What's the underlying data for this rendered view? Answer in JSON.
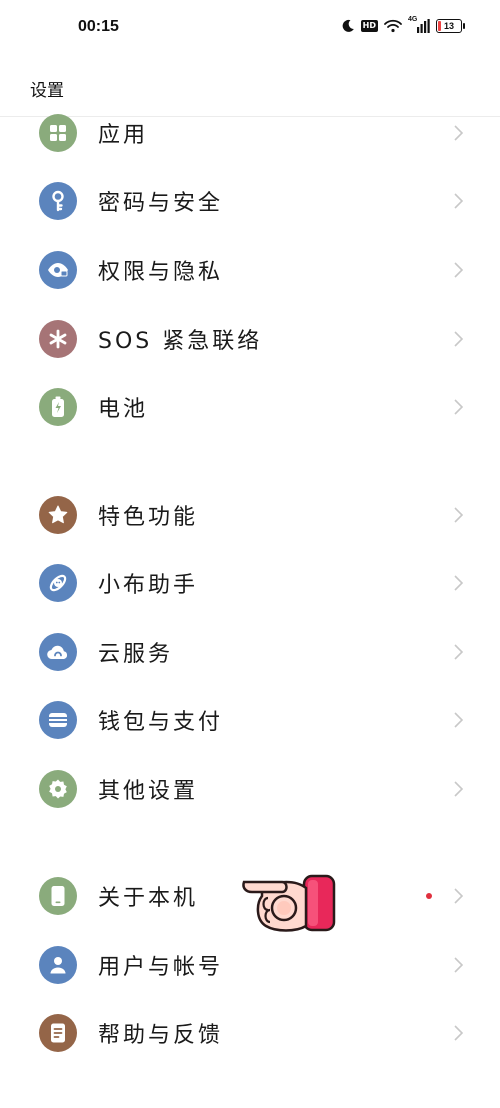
{
  "status_bar": {
    "time": "00:15",
    "icons": [
      "moon-icon",
      "hd-icon",
      "wifi-icon",
      "4g-signal-icon",
      "battery-icon"
    ],
    "hd_label": "HD",
    "network_label": "4G",
    "battery_level": "13"
  },
  "header": {
    "title": "设置"
  },
  "colors": {
    "green": "#8aab7c",
    "blue": "#5b84bd",
    "mauve": "#a67476",
    "brown": "#946548",
    "notification_dot": "#e0303e"
  },
  "groups": [
    {
      "items": [
        {
          "label": "应用",
          "icon": "apps-grid-icon"
        },
        {
          "label": "密码与安全",
          "icon": "key-icon"
        },
        {
          "label": "权限与隐私",
          "icon": "eye-lock-icon"
        },
        {
          "label": "SOS 紧急联络",
          "icon": "asterisk-icon"
        },
        {
          "label": "电池",
          "icon": "battery-icon"
        }
      ]
    },
    {
      "items": [
        {
          "label": "特色功能",
          "icon": "star-icon"
        },
        {
          "label": "小布助手",
          "icon": "assistant-icon"
        },
        {
          "label": "云服务",
          "icon": "cloud-icon"
        },
        {
          "label": "钱包与支付",
          "icon": "wallet-icon"
        },
        {
          "label": "其他设置",
          "icon": "gear-icon"
        }
      ]
    },
    {
      "items": [
        {
          "label": "关于本机",
          "icon": "phone-icon"
        },
        {
          "label": "用户与帐号",
          "icon": "user-icon"
        },
        {
          "label": "帮助与反馈",
          "icon": "feedback-icon"
        }
      ]
    }
  ]
}
